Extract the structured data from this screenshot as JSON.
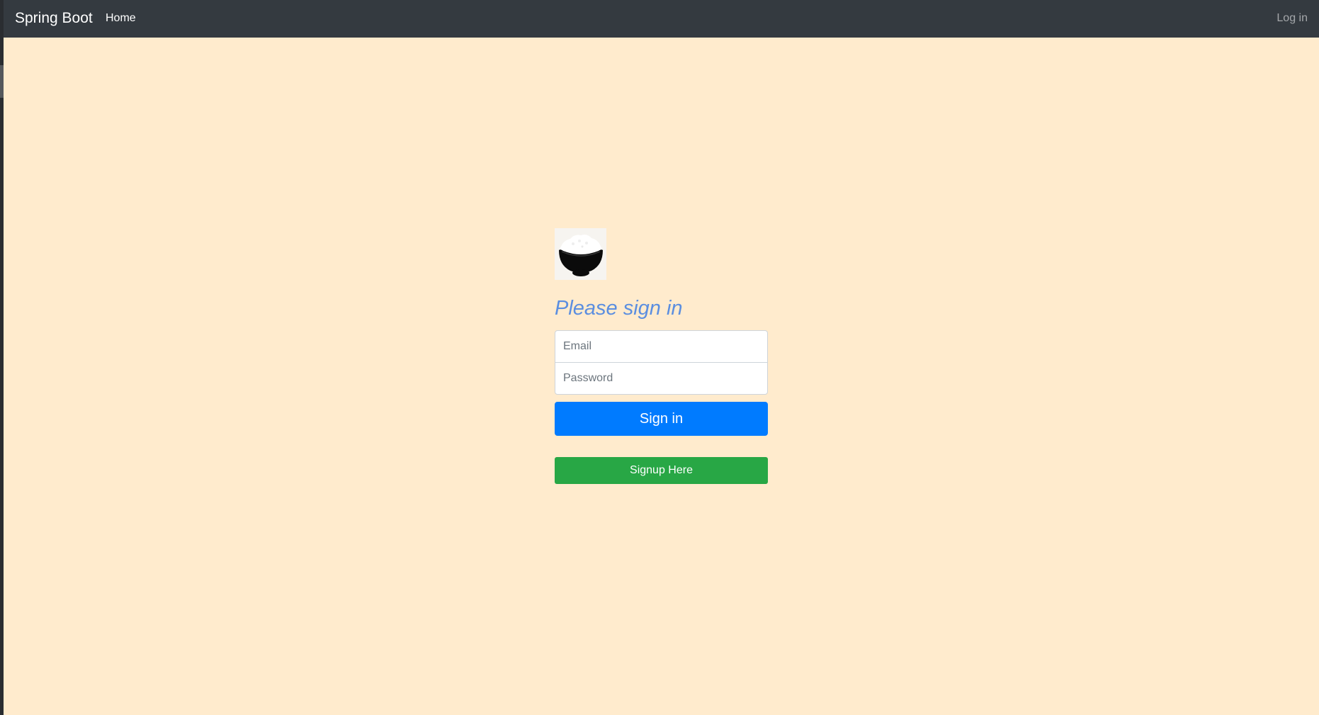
{
  "navbar": {
    "brand": "Spring Boot",
    "home_label": "Home",
    "login_label": "Log in",
    "background_color": "#343a40"
  },
  "page": {
    "background_color": "#ffebcd"
  },
  "form": {
    "logo_icon": "rice-bowl-icon",
    "heading": "Please sign in",
    "heading_color": "#5b8ee0",
    "email_placeholder": "Email",
    "email_value": "",
    "password_placeholder": "Password",
    "password_value": "",
    "signin_label": "Sign in",
    "signin_color": "#007bff",
    "signup_label": "Signup Here",
    "signup_color": "#28a745"
  }
}
